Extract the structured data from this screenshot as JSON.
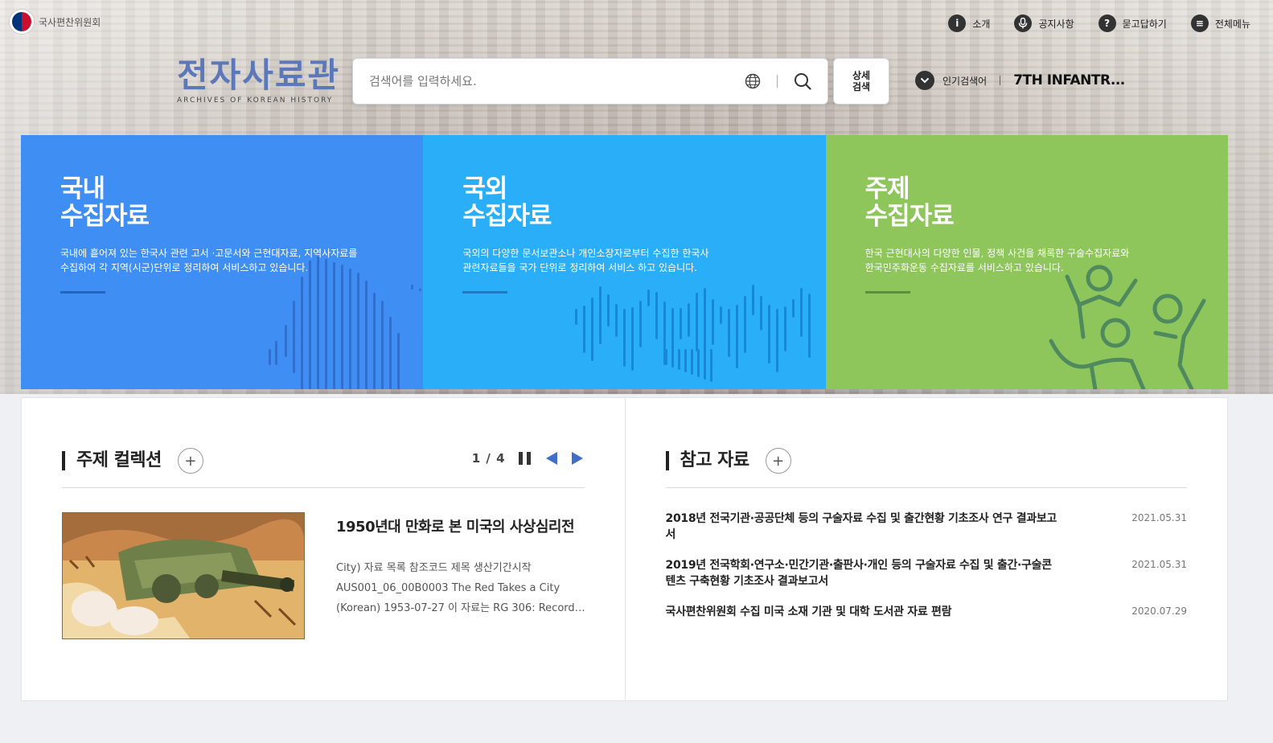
{
  "header": {
    "gov_name": "국사편찬위원회",
    "logo_title": "전자사료관",
    "logo_sub": "ARCHIVES OF KOREAN HISTORY",
    "nav": [
      {
        "label": "소개",
        "icon": "info-icon",
        "glyph": "i"
      },
      {
        "label": "공지사항",
        "icon": "microphone-icon",
        "glyph": "♪"
      },
      {
        "label": "묻고답하기",
        "icon": "question-icon",
        "glyph": "?"
      },
      {
        "label": "전체메뉴",
        "icon": "menu-icon",
        "glyph": "≡"
      }
    ]
  },
  "search": {
    "placeholder": "검색어를 입력하세요.",
    "advanced_line1": "상세",
    "advanced_line2": "검색",
    "popular_label": "인기검색어",
    "popular_term": "7TH INFANTR..."
  },
  "tiles": [
    {
      "title_line1": "국내",
      "title_line2": "수집자료",
      "desc_line1": "국내에 흩어져 있는 한국사 관련 고서 ·고문서와 근현대자료, 지역사자료를",
      "desc_line2": "수집하여 각 지역(시군)단위로 정리하여 서비스하고 있습니다.",
      "color": "#3f8ef4"
    },
    {
      "title_line1": "국외",
      "title_line2": "수집자료",
      "desc_line1": "국외의 다양한 문서보관소나 개인소장자로부터 수집한 한국사",
      "desc_line2": "관련자료들을 국가 단위로 정리하여 서비스 하고 있습니다.",
      "color": "#2aaef8"
    },
    {
      "title_line1": "주제",
      "title_line2": "수집자료",
      "desc_line1": "한국 근현대사의 다양한 인물, 정책 사건을 채록한 구술수집자료와",
      "desc_line2": "한국민주화운동 수집자료를 서비스하고 있습니다.",
      "color": "#8fc65c"
    }
  ],
  "collection": {
    "title": "주제 컬렉션",
    "plus": "+",
    "pager": "1 / 4",
    "feature_title": "1950년대 만화로 본 미국의 사상심리전",
    "feature_desc": [
      "City) 자료 목록 참조코드 제목 생산기간시작",
      "AUS001_06_00B0003 The Red Takes a City",
      "(Korean) 1953-07-27 이 자료는 RG 306: Records..."
    ]
  },
  "references": {
    "title": "참고 자료",
    "plus": "+",
    "items": [
      {
        "title": "2018년 전국기관·공공단체 등의 구술자료 수집 및 출간현황 기초조사 연구 결과보고서",
        "date": "2021.05.31"
      },
      {
        "title": "2019년 전국학회·연구소·민간기관·출판사·개인 등의 구술자료 수집 및 출간·구술콘텐츠 구축현황 기초조사 결과보고서",
        "date": "2021.05.31"
      },
      {
        "title": "국사편찬위원회 수집 미국 소재 기관 및 대학 도서관 자료 편람",
        "date": "2020.07.29"
      }
    ]
  }
}
